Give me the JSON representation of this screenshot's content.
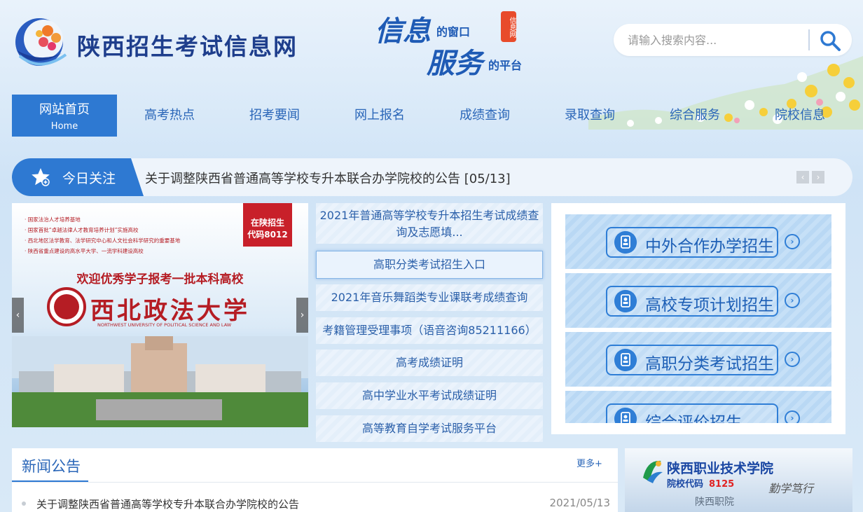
{
  "header": {
    "site_title": "陕西招生考试信息网",
    "slogan": {
      "line1_big": "信息",
      "line1_small": "的窗口",
      "line2_big": "服务",
      "line2_small": "的平台",
      "stamp": "信息网"
    },
    "search": {
      "placeholder": "请输入搜索内容..."
    }
  },
  "nav": {
    "items": [
      {
        "label": "网站首页",
        "sub": "Home"
      },
      {
        "label": "高考热点"
      },
      {
        "label": "招考要闻"
      },
      {
        "label": "网上报名"
      },
      {
        "label": "成绩查询"
      },
      {
        "label": "录取查询"
      },
      {
        "label": "综合服务"
      },
      {
        "label": "院校信息"
      }
    ]
  },
  "focus": {
    "label": "今日关注",
    "headline": "关于调整陕西省普通高等学校专升本联合办学院校的公告  [05/13]"
  },
  "banner": {
    "bullets": [
      "· 国家法治人才培养基地",
      "· 国家首批“卓越法律人才教育培养计划”实施高校",
      "· 西北地区法学教育、法学研究中心和人文社会科学研究的重要基地",
      "· 陕西省重点建设的高水平大学、一流学科建设高校"
    ],
    "badge_line1": "在陕招生",
    "badge_line2": "代码8012",
    "welcome": "欢迎优秀学子报考一批本科高校",
    "school_cn": "西北政法大学",
    "school_en": "NORTHWEST UNIVERSITY OF POLITICAL SCIENCE AND LAW"
  },
  "mid_list": [
    "2021年普通高等学校专升本招生考试成绩查询及志愿填...",
    "高职分类考试招生入口",
    "2021年音乐舞蹈类专业课联考成绩查询",
    "考籍管理受理事项（语音咨询85211166）",
    "高考成绩证明",
    "高中学业水平考试成绩证明",
    "高等教育自学考试服务平台"
  ],
  "right_buttons": [
    "中外合作办学招生",
    "高校专项计划招生",
    "高职分类考试招生",
    "综合评价招生"
  ],
  "news": {
    "title": "新闻公告",
    "more": "更多+",
    "items": [
      {
        "text": "关于调整陕西省普通高等学校专升本联合办学院校的公告",
        "date": "2021/05/13"
      }
    ]
  },
  "ad": {
    "title": "陕西职业技术学院",
    "code_label": "院校代码",
    "code": "8125",
    "sign": "陕西职院",
    "motto": "勤学笃行"
  },
  "colors": {
    "primary": "#2e79d2",
    "link": "#2a66b8"
  }
}
